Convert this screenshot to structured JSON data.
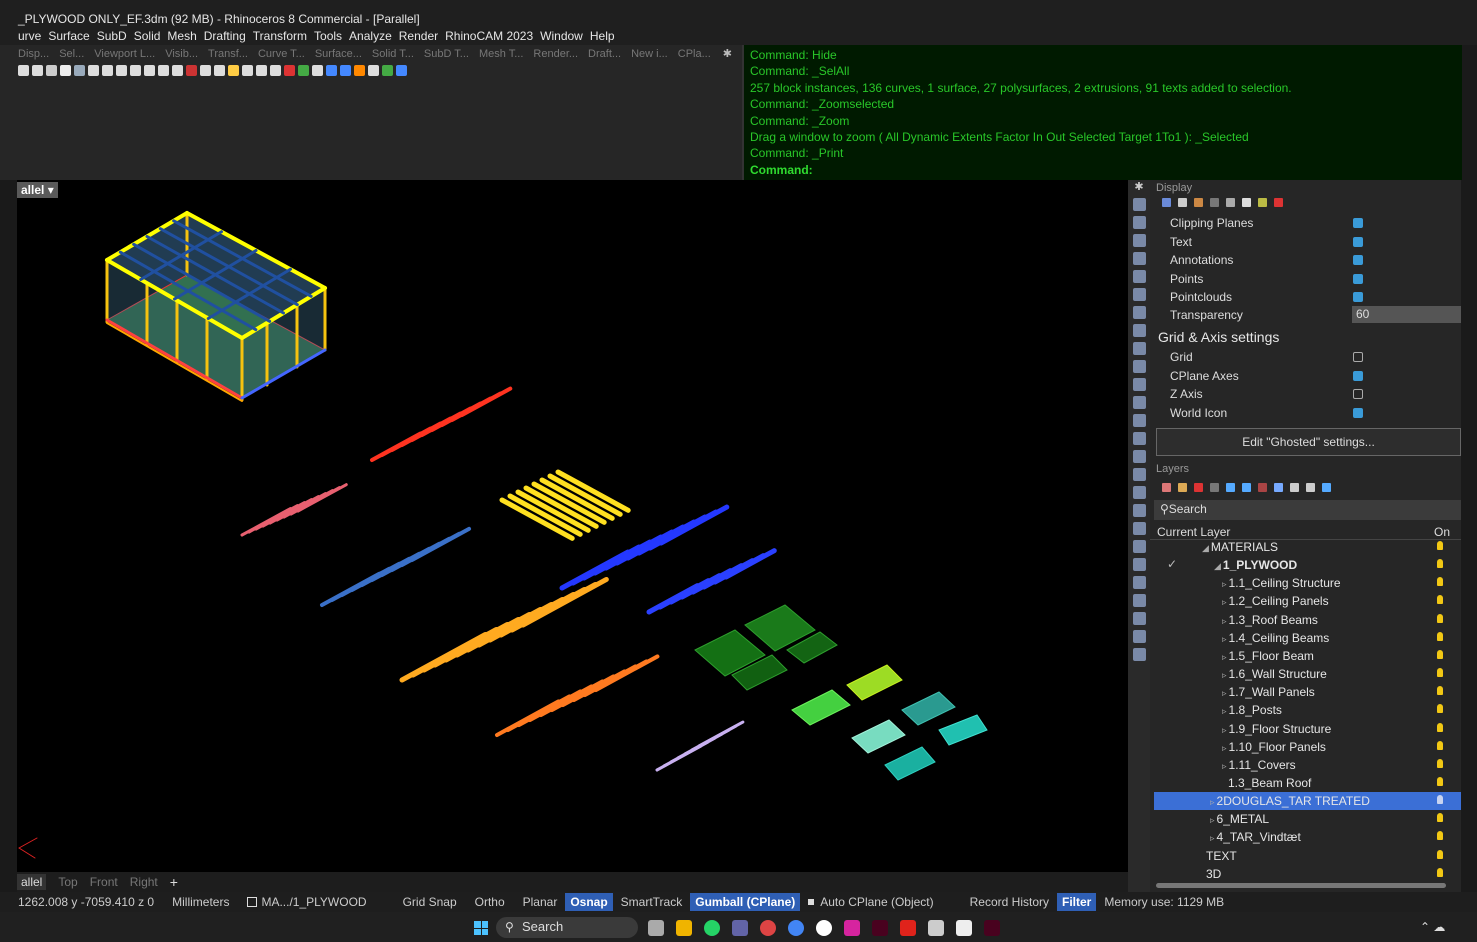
{
  "window": {
    "title": "_PLYWOOD ONLY_EF.3dm (92 MB) - Rhinoceros 8 Commercial - [Parallel]"
  },
  "menu": [
    "urve",
    "Surface",
    "SubD",
    "Solid",
    "Mesh",
    "Drafting",
    "Transform",
    "Tools",
    "Analyze",
    "Render",
    "RhinoCAM 2023",
    "Window",
    "Help"
  ],
  "toolbar_tabs": [
    "Disp...",
    "Sel...",
    "Viewport L...",
    "Visib...",
    "Transf...",
    "Curve T...",
    "Surface...",
    "Solid T...",
    "SubD T...",
    "Mesh T...",
    "Render...",
    "Draft...",
    "New i...",
    "CPla..."
  ],
  "command_history": [
    "Command: Hide",
    "Command: _SelAll",
    "257 block instances, 136 curves, 1 surface, 27 polysurfaces, 2 extrusions, 91 texts added to selection.",
    "Command: _Zoomselected",
    "Command: _Zoom",
    "Drag a window to zoom ( All  Dynamic  Extents  Factor  In  Out  Selected  Target  1To1 ): _Selected",
    "Command: _Print"
  ],
  "command_prompt": "Command:",
  "viewport": {
    "label": "allel",
    "dropdown_icon": "chevron-down-icon"
  },
  "display_panel": {
    "title": "Display",
    "rows": [
      {
        "label": "Clipping Planes",
        "checked": true
      },
      {
        "label": "Text",
        "checked": true
      },
      {
        "label": "Annotations",
        "checked": true
      },
      {
        "label": "Points",
        "checked": true
      },
      {
        "label": "Pointclouds",
        "checked": true
      }
    ],
    "transparency_label": "Transparency",
    "transparency_value": "60",
    "grid_section": "Grid & Axis settings",
    "grid_rows": [
      {
        "label": "Grid",
        "checked": false
      },
      {
        "label": "CPlane Axes",
        "checked": true
      },
      {
        "label": "Z Axis",
        "checked": false
      },
      {
        "label": "World Icon",
        "checked": true
      }
    ],
    "ghost_button": "Edit \"Ghosted\" settings..."
  },
  "layers_panel": {
    "title": "Layers",
    "search_placeholder": "Search",
    "col_current": "Current Layer",
    "col_on": "On",
    "rows": [
      {
        "name": "MATERIALS",
        "indent": 48,
        "arrow": "◢",
        "bold": false
      },
      {
        "name": "1_PLYWOOD",
        "indent": 60,
        "arrow": "◢",
        "bold": true,
        "current": true
      },
      {
        "name": "1.1_Ceiling Structure",
        "indent": 68,
        "arrow": "▹"
      },
      {
        "name": "1.2_Ceiling Panels",
        "indent": 68,
        "arrow": "▹"
      },
      {
        "name": "1.3_Roof Beams",
        "indent": 68,
        "arrow": "▹"
      },
      {
        "name": "1.4_Ceiling Beams",
        "indent": 68,
        "arrow": "▹"
      },
      {
        "name": "1.5_Floor Beam",
        "indent": 68,
        "arrow": "▹"
      },
      {
        "name": "1.6_Wall Structure",
        "indent": 68,
        "arrow": "▹"
      },
      {
        "name": "1.7_Wall Panels",
        "indent": 68,
        "arrow": "▹"
      },
      {
        "name": "1.8_Posts",
        "indent": 68,
        "arrow": "▹"
      },
      {
        "name": "1.9_Floor Structure",
        "indent": 68,
        "arrow": "▹"
      },
      {
        "name": "1.10_Floor Panels",
        "indent": 68,
        "arrow": "▹"
      },
      {
        "name": "1.11_Covers",
        "indent": 68,
        "arrow": "▹"
      },
      {
        "name": "1.3_Beam Roof",
        "indent": 74,
        "arrow": ""
      },
      {
        "name": "2DOUGLAS_TAR TREATED",
        "indent": 56,
        "arrow": "▹",
        "selected": true
      },
      {
        "name": "6_METAL",
        "indent": 56,
        "arrow": "▹"
      },
      {
        "name": "4_TAR_Vindtæt",
        "indent": 56,
        "arrow": "▹"
      },
      {
        "name": "TEXT",
        "indent": 52,
        "arrow": ""
      },
      {
        "name": "3D",
        "indent": 52,
        "arrow": ""
      }
    ]
  },
  "viewport_tabs": [
    "allel",
    "Top",
    "Front",
    "Right",
    "+"
  ],
  "statusbar": {
    "coords": "1262.008  y -7059.410  z 0",
    "units": "Millimeters",
    "layer": "MA.../1_PLYWOOD",
    "grid_snap": "Grid Snap",
    "ortho": "Ortho",
    "planar": "Planar",
    "osnap": "Osnap",
    "smarttrack": "SmartTrack",
    "gumball": "Gumball (CPlane)",
    "autocplane": "Auto CPlane (Object)",
    "record_history": "Record History",
    "filter": "Filter",
    "memory": "Memory use: 1129 MB"
  },
  "taskbar": {
    "search": "Search",
    "tray_icon": "chevron-up-icon"
  },
  "colors": {
    "command_text": "#29c729",
    "selection": "#3b6fd6",
    "bulb": "#f2c814",
    "checkbox": "#3a9bd8"
  }
}
